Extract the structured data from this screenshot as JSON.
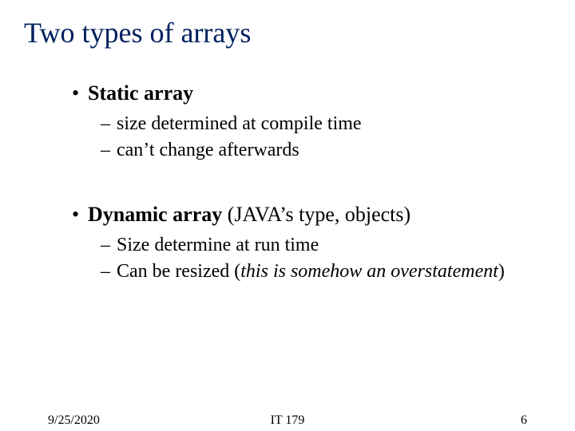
{
  "slide": {
    "title": "Two types of arrays",
    "items": [
      {
        "bullet": "• ",
        "label_bold": "Static array",
        "label_rest": "",
        "subs": [
          {
            "dash": "– ",
            "pre": "size determined at ",
            "em": "compile",
            "post": " time"
          },
          {
            "dash": "– ",
            "pre": "can’t change afterwards",
            "em": "",
            "post": ""
          }
        ]
      },
      {
        "bullet": "• ",
        "label_bold": "Dynamic array",
        "label_rest": "   (JAVA’s type,  objects)",
        "subs": [
          {
            "dash": "– ",
            "pre": "Size determine at ",
            "em": "run",
            "post": " time"
          },
          {
            "dash": "– ",
            "pre": "Can be resized (",
            "ital": "this is somehow an overstatement",
            "post2": ")"
          }
        ]
      }
    ]
  },
  "footer": {
    "date": "9/25/2020",
    "course": "IT 179",
    "page": "6"
  }
}
